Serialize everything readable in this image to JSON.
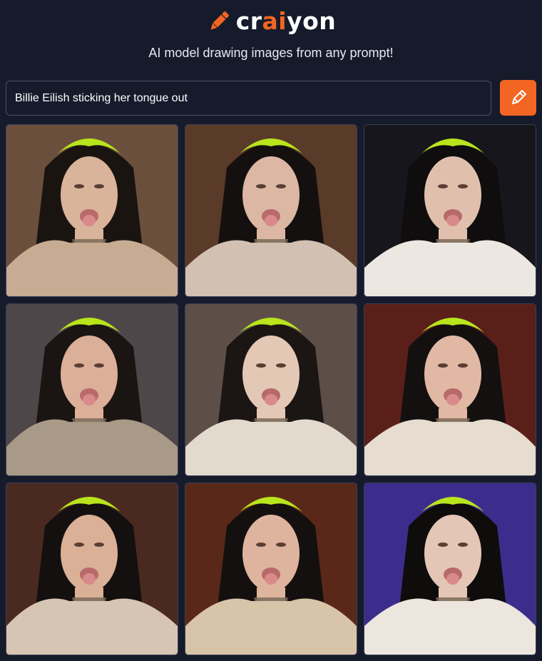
{
  "logo": {
    "prefix": "cr",
    "highlight": "ai",
    "suffix": "yon",
    "accent_color": "#f26522"
  },
  "tagline": "AI model drawing images from any prompt!",
  "search": {
    "value": "Billie Eilish sticking her tongue out",
    "button_icon": "pencil-icon"
  },
  "colors": {
    "background": "#161b2c",
    "accent": "#f26522",
    "hair_highlight": "#b8e51c"
  },
  "images": [
    {
      "bg": "#6b4f3d",
      "skin": "#d9b39a",
      "outfit": "#c8ab93",
      "hair": "#1a1410"
    },
    {
      "bg": "#5a3a28",
      "skin": "#dcb8a4",
      "outfit": "#d2c0b2",
      "hair": "#151010"
    },
    {
      "bg": "#16161c",
      "skin": "#e0c0ad",
      "outfit": "#ece8e1",
      "hair": "#0f0d0d"
    },
    {
      "bg": "#4e4648",
      "skin": "#dcaf99",
      "outfit": "#a89a86",
      "hair": "#1a1412"
    },
    {
      "bg": "#5e4e48",
      "skin": "#e4c8b6",
      "outfit": "#e3dace",
      "hair": "#1b1614"
    },
    {
      "bg": "#5b1f1a",
      "skin": "#e0b8a4",
      "outfit": "#e6ddd0",
      "hair": "#141010"
    },
    {
      "bg": "#4a2a20",
      "skin": "#dab096",
      "outfit": "#d6c5b2",
      "hair": "#141010"
    },
    {
      "bg": "#5a2818",
      "skin": "#dfb49e",
      "outfit": "#d8c4a8",
      "hair": "#141010"
    },
    {
      "bg": "#3c2d8c",
      "skin": "#e4c6b6",
      "outfit": "#ece6de",
      "hair": "#0f0c0c"
    }
  ]
}
